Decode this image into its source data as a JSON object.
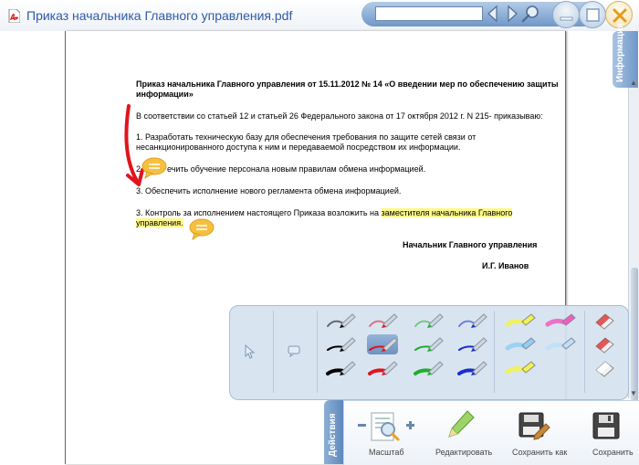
{
  "window": {
    "title": "Приказ начальника Главного управления.pdf"
  },
  "toolbar": {
    "search_value": "",
    "search_placeholder": ""
  },
  "side_tabs": {
    "info": "Информация",
    "actions": "Действия"
  },
  "document": {
    "heading_line1": "Приказ начальника Главного управления от 15.11.2012 № 14 «О введении мер по обеспечению защиты",
    "heading_line2": "информации»",
    "intro": "В соответствии со статьей 12 и статьей 26 Федерального закона от 17 октября 2012 г. N 215- приказываю:",
    "item1_line1": "1. Разработать техническую базу для обеспечения требования по защите сетей связи от",
    "item1_line2": "несанкционированного доступа к ним и передаваемой посредством их информации.",
    "item2_prefix": "2. ",
    "item2_text": "ечить обучение персонала новым правилам обмена информацией.",
    "item3": "3. Обеспечить исполнение нового регламента обмена информацией.",
    "item4_prefix": "3. Контроль за исполнением настоящего Приказа возложить на ",
    "item4_highlight1": "заместителя  начальника Главного",
    "item4_highlight2": "управления.",
    "signature_title": "Начальник Главного управления",
    "signature_name": "И.Г. Иванов"
  },
  "actions": {
    "zoom": "Масштаб",
    "edit": "Редактировать",
    "save_as": "Сохранить как",
    "save": "Сохранить"
  },
  "colors": {
    "accent": "#6f97c8",
    "title_text": "#2e5aa8",
    "highlight": "#fdf98a",
    "annotation_arrow": "#e0141c",
    "note_bubble": "#f5c040",
    "pen_colors": [
      "#000000",
      "#e0141c",
      "#1fae2c",
      "#1a2fc8"
    ],
    "marker_colors": [
      "#f3f24a",
      "#f05cc0",
      "#8ed0f5",
      "#bde0f7"
    ]
  },
  "icons": {
    "pdf": "pdf-icon",
    "search": "search-icon",
    "prev": "prev-icon",
    "next": "next-icon",
    "minimize": "minimize-icon",
    "maximize": "maximize-icon",
    "close": "close-icon",
    "arrow_annotation": "arrow-annotation-icon",
    "note": "note-icon",
    "pen": "pen-icon",
    "marker": "marker-icon",
    "eraser": "eraser-icon",
    "zoom": "zoom-icon",
    "edit": "edit-icon",
    "save_as": "save-as-icon",
    "save": "save-icon"
  }
}
